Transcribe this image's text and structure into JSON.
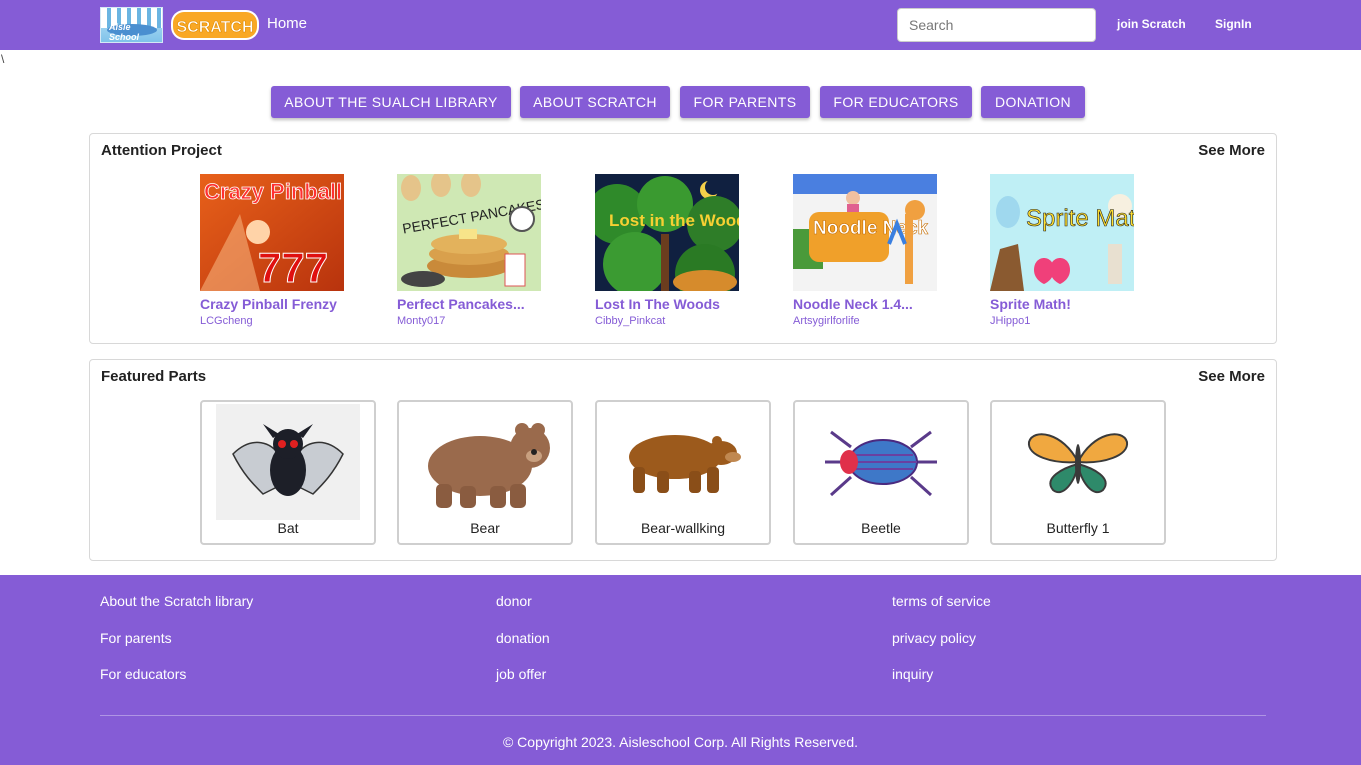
{
  "header": {
    "logo_text": "Aisle School",
    "scratch_logo_text": "SCRATCH",
    "home_label": "Home",
    "search_placeholder": "Search",
    "join_label": "join Scratch",
    "signin_label": "SignIn"
  },
  "stray_char": "\\",
  "nav": {
    "buttons": [
      "ABOUT THE SUALCH LIBRARY",
      "ABOUT SCRATCH",
      "FOR PARENTS",
      "FOR EDUCATORS",
      "DONATION"
    ]
  },
  "attention": {
    "title": "Attention Project",
    "see_more": "See More",
    "projects": [
      {
        "title": "Crazy Pinball Frenzy",
        "author": "LCGcheng",
        "thumb_text": "Crazy Pinball",
        "thumb_sub": "777"
      },
      {
        "title": "Perfect Pancakes...",
        "author": "Monty017",
        "thumb_text": "PERFECT PANCAKES"
      },
      {
        "title": "Lost In The Woods",
        "author": "Cibby_Pinkcat",
        "thumb_text": "Lost in the Woods"
      },
      {
        "title": "Noodle Neck 1.4...",
        "author": "Artsygirlforlife",
        "thumb_text": "Noodle Neck"
      },
      {
        "title": "Sprite Math!",
        "author": "JHippo1",
        "thumb_text": "Sprite Math"
      }
    ]
  },
  "featured": {
    "title": "Featured Parts",
    "see_more": "See More",
    "parts": [
      {
        "label": "Bat",
        "icon": "bat-icon"
      },
      {
        "label": "Bear",
        "icon": "bear-icon"
      },
      {
        "label": "Bear-wallking",
        "icon": "bear-walking-icon"
      },
      {
        "label": "Beetle",
        "icon": "beetle-icon"
      },
      {
        "label": "Butterfly 1",
        "icon": "butterfly-icon"
      }
    ]
  },
  "footer": {
    "col1": [
      "About the Scratch library",
      "For parents",
      "For educators"
    ],
    "col2": [
      "donor",
      "donation",
      "job offer"
    ],
    "col3": [
      "terms of service",
      "privacy policy",
      "inquiry"
    ],
    "copyright": "© Copyright 2023. Aisleschool Corp. All Rights Reserved."
  },
  "colors": {
    "brand_purple": "#855cd6",
    "link_purple": "#855cd6"
  }
}
